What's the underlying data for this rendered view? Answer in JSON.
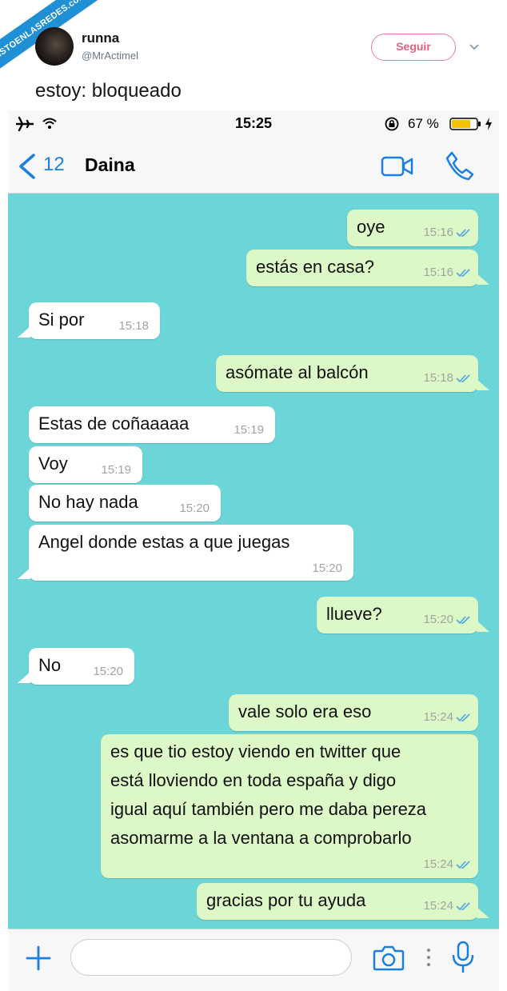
{
  "watermark": "VISTOENLASREDES.com",
  "tweet": {
    "display_name": "runna",
    "handle": "@MrActimel",
    "follow_label": "Seguir",
    "text": "estoy: bloqueado"
  },
  "status_bar": {
    "time": "15:25",
    "battery": "67 %"
  },
  "chat_header": {
    "back_count": "12",
    "contact_name": "Daina"
  },
  "messages": [
    {
      "dir": "out",
      "text": "oye",
      "time": "15:16"
    },
    {
      "dir": "out",
      "text": "estás en casa?",
      "time": "15:16"
    },
    {
      "dir": "in",
      "text": "Si por",
      "time": "15:18"
    },
    {
      "dir": "out",
      "text": "asómate al balcón",
      "time": "15:18"
    },
    {
      "dir": "in",
      "text": "Estas de coñaaaaa",
      "time": "15:19"
    },
    {
      "dir": "in",
      "text": "Voy",
      "time": "15:19"
    },
    {
      "dir": "in",
      "text": "No hay nada",
      "time": "15:20"
    },
    {
      "dir": "in",
      "text": "Angel donde estas a que juegas",
      "time": "15:20"
    },
    {
      "dir": "out",
      "text": "llueve?",
      "time": "15:20"
    },
    {
      "dir": "in",
      "text": "No",
      "time": "15:20"
    },
    {
      "dir": "out",
      "text": "vale solo era eso",
      "time": "15:24"
    },
    {
      "dir": "out",
      "lines": [
        "es que tio estoy viendo en twitter que",
        "está lloviendo en toda españa y digo",
        "igual aquí también pero me daba pereza",
        "asomarme a la ventana a comprobarlo"
      ],
      "time": "15:24"
    },
    {
      "dir": "out",
      "text": "gracias por tu ayuda",
      "time": "15:24"
    }
  ],
  "colors": {
    "chat_bg": "#6cd5d8",
    "outgoing_bubble": "#dcf8c6",
    "incoming_bubble": "#ffffff",
    "ios_blue": "#1a7fe0",
    "follow_pink": "#e0607e",
    "watermark_blue": "#1f8fd6"
  },
  "icons": [
    "airplane-icon",
    "wifi-icon",
    "rotation-lock-icon",
    "battery-icon",
    "charging-icon",
    "back-chevron-icon",
    "video-call-icon",
    "phone-call-icon",
    "plus-icon",
    "camera-icon",
    "more-dots-icon",
    "microphone-icon",
    "double-check-icon"
  ]
}
